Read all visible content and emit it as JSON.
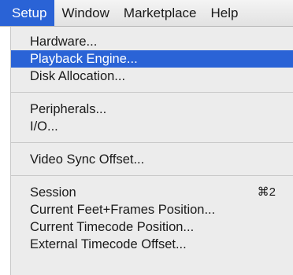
{
  "menubar": {
    "items": [
      {
        "label": "Setup"
      },
      {
        "label": "Window"
      },
      {
        "label": "Marketplace"
      },
      {
        "label": "Help"
      }
    ]
  },
  "setup_menu": {
    "hardware": "Hardware...",
    "playback_engine": "Playback Engine...",
    "disk_allocation": "Disk Allocation...",
    "peripherals": "Peripherals...",
    "io": "I/O...",
    "video_sync_offset": "Video Sync Offset...",
    "session": "Session",
    "session_shortcut": "⌘2",
    "current_feet_frames": "Current Feet+Frames Position...",
    "current_timecode": "Current Timecode Position...",
    "external_timecode_offset": "External Timecode Offset..."
  },
  "colors": {
    "highlight": "#2a63d6",
    "menu_background": "#ececec"
  }
}
